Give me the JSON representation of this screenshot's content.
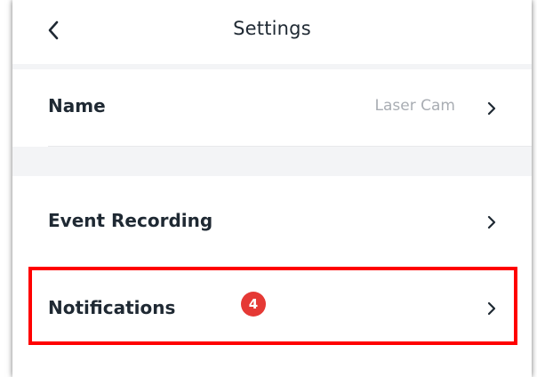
{
  "header": {
    "title": "Settings",
    "back_icon": "chevron-left-icon"
  },
  "rows": {
    "name": {
      "label": "Name",
      "value": "Laser Cam",
      "icon": "chevron-right-icon"
    },
    "event_recording": {
      "label": "Event Recording",
      "icon": "chevron-right-icon"
    },
    "notifications": {
      "label": "Notifications",
      "icon": "chevron-right-icon"
    }
  },
  "annotation": {
    "step_badge": "4",
    "badge_color": "#e53935",
    "highlight_color": "#ff0000"
  }
}
